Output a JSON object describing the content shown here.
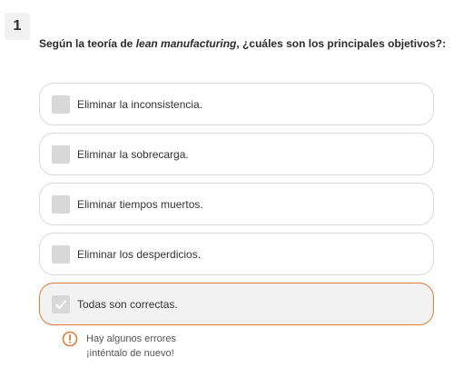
{
  "question": {
    "number": "1",
    "text_before": "Según la teoría de ",
    "text_emphasis": "lean manufacturing",
    "text_after": ", ¿cuáles son los principales objetivos?:"
  },
  "options": [
    {
      "label": "Eliminar la inconsistencia.",
      "checked": false
    },
    {
      "label": "Eliminar la sobrecarga.",
      "checked": false
    },
    {
      "label": "Eliminar tiempos muertos.",
      "checked": false
    },
    {
      "label": "Eliminar los desperdicios.",
      "checked": false
    },
    {
      "label": "Todas son correctas.",
      "checked": true
    }
  ],
  "feedback": {
    "icon": "warning-circle-icon",
    "line1": "Hay algunos errores",
    "line2": "¡inténtalo de nuevo!"
  },
  "colors": {
    "accent": "#e07b39",
    "checkbox": "#d8d8d8",
    "selected_bg": "#f2f2f2"
  }
}
